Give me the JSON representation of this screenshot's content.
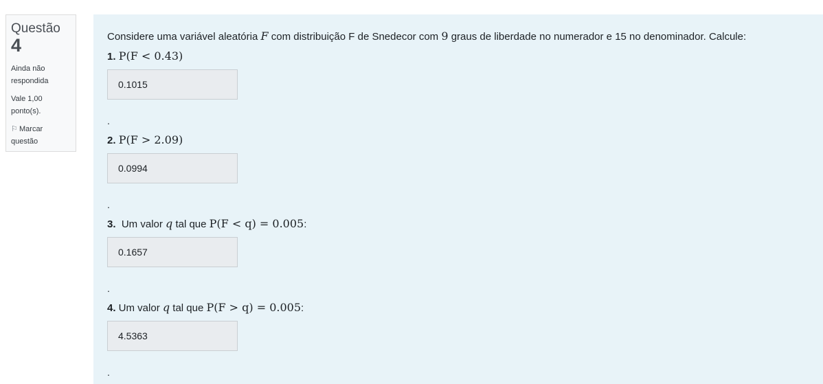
{
  "info": {
    "question_label": "Questão",
    "question_number": "4",
    "status": "Ainda não respondida",
    "points": "Vale 1,00 ponto(s).",
    "flag_label": "Marcar questão",
    "flag_icon": "flag-icon"
  },
  "question": {
    "intro_before_F": "Considere uma variável aleatória ",
    "intro_var": "F",
    "intro_after_F": " com distribuição F de Snedecor  com ",
    "intro_num": "9",
    "intro_end": " graus de liberdade no numerador e 15 no denominador. Calcule:"
  },
  "items": [
    {
      "label": "1.",
      "text": "",
      "math": "P(F < 0.43)",
      "suffix": "",
      "answer": "0.1015",
      "dot": "."
    },
    {
      "label": "2.",
      "text": "",
      "math": "P(F > 2.09)",
      "suffix": "",
      "answer": "0.0994",
      "dot": "."
    },
    {
      "label": "3.",
      "text": "  Um valor ",
      "qvar": "q",
      "text2": " tal que ",
      "math": "P(F < q) = 0.005",
      "suffix": ":",
      "answer": "0.1657",
      "dot": "."
    },
    {
      "label": "4.",
      "text": " Um valor ",
      "qvar": "q",
      "text2": " tal que ",
      "math": "P(F > q) = 0.005",
      "suffix": ":",
      "answer": "4.5363",
      "dot": "."
    }
  ]
}
